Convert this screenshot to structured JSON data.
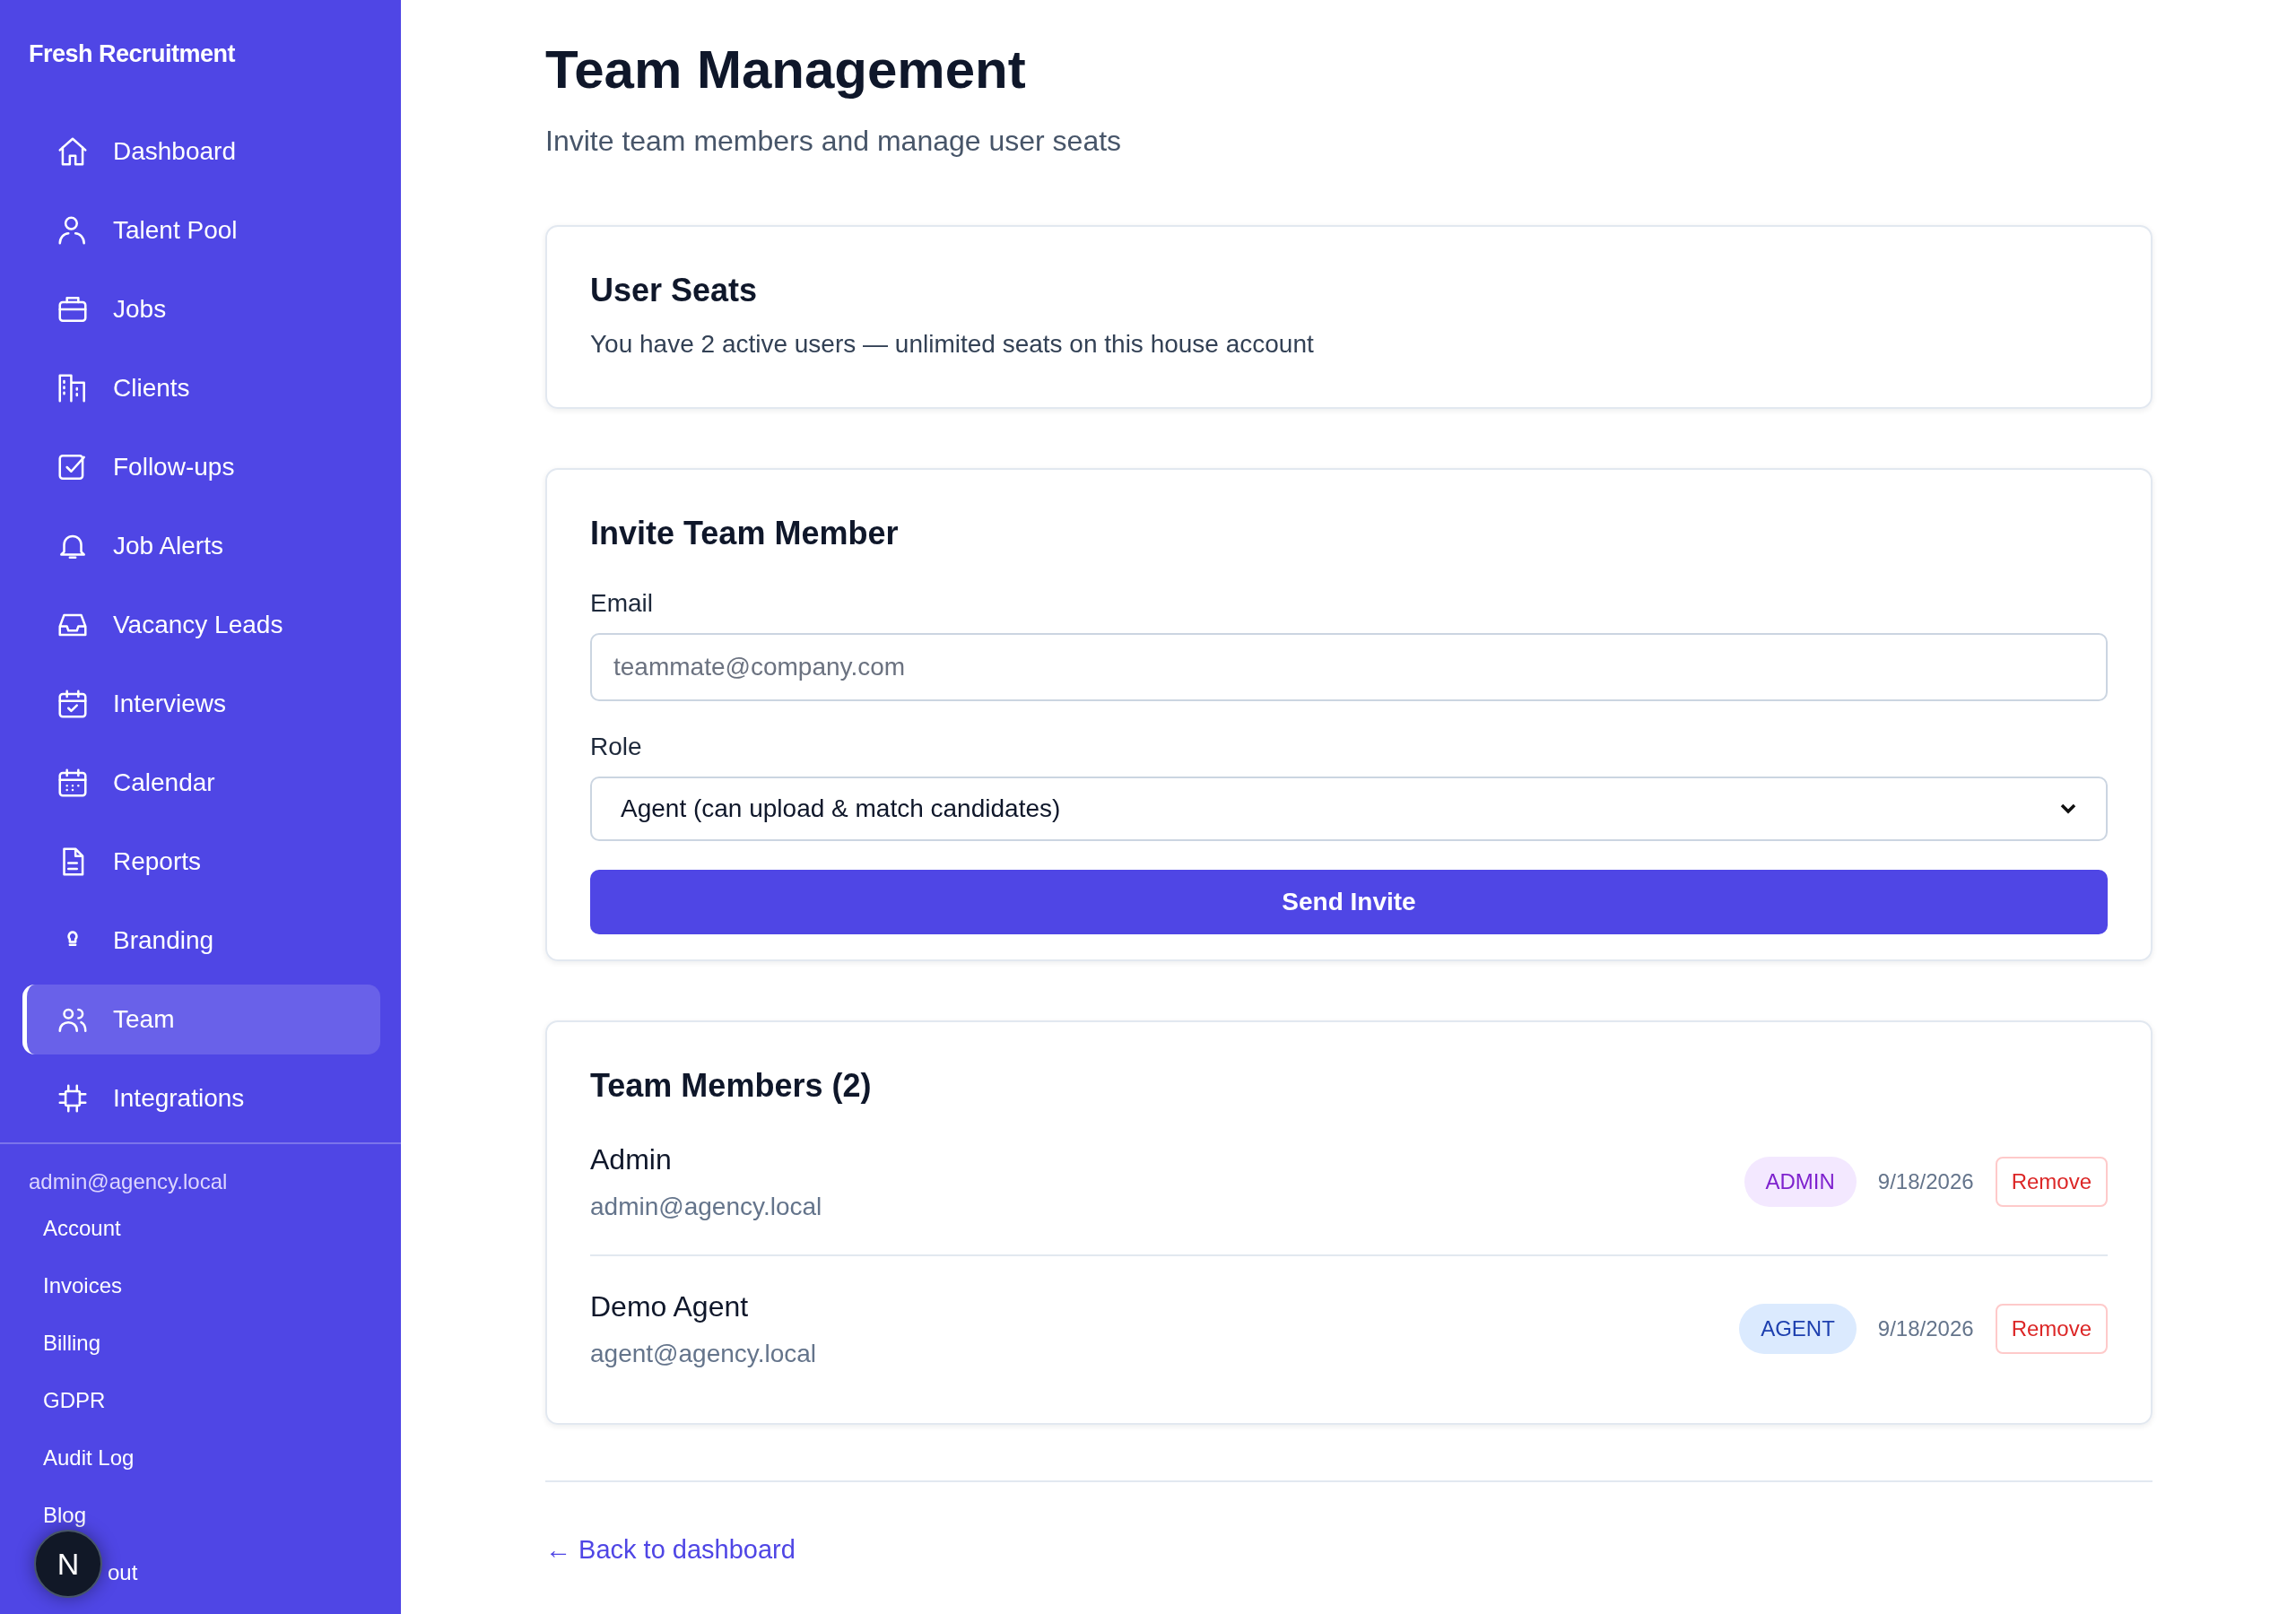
{
  "sidebar": {
    "brand": "Fresh Recruitment",
    "items": [
      {
        "label": "Dashboard",
        "selected": false
      },
      {
        "label": "Talent Pool",
        "selected": false
      },
      {
        "label": "Jobs",
        "selected": false
      },
      {
        "label": "Clients",
        "selected": false
      },
      {
        "label": "Follow-ups",
        "selected": false
      },
      {
        "label": "Job Alerts",
        "selected": false
      },
      {
        "label": "Vacancy Leads",
        "selected": false
      },
      {
        "label": "Interviews",
        "selected": false
      },
      {
        "label": "Calendar",
        "selected": false
      },
      {
        "label": "Reports",
        "selected": false
      },
      {
        "label": "Branding",
        "selected": false
      },
      {
        "label": "Team",
        "selected": true
      },
      {
        "label": "Integrations",
        "selected": false
      }
    ],
    "user_email": "admin@agency.local",
    "account_links": [
      "Account",
      "Invoices",
      "Billing",
      "GDPR",
      "Audit Log",
      "Blog",
      "out"
    ],
    "dev_badge": "N"
  },
  "page": {
    "title": "Team Management",
    "subtitle": "Invite team members and manage user seats"
  },
  "seats_card": {
    "title": "User Seats",
    "text": "You have 2 active users — unlimited seats on this house account"
  },
  "invite_card": {
    "title": "Invite Team Member",
    "email_label": "Email",
    "email_placeholder": "teammate@company.com",
    "role_label": "Role",
    "role_value": "Agent (can upload & match candidates)",
    "button": "Send Invite"
  },
  "members_card": {
    "title": "Team Members (2)",
    "members": [
      {
        "name": "Admin",
        "email": "admin@agency.local",
        "role": "ADMIN",
        "kind": "admin",
        "date": "9/18/2026",
        "action": "Remove"
      },
      {
        "name": "Demo Agent",
        "email": "agent@agency.local",
        "role": "AGENT",
        "kind": "agent",
        "date": "9/18/2026",
        "action": "Remove"
      }
    ]
  },
  "back_link": "← Back to dashboard"
}
